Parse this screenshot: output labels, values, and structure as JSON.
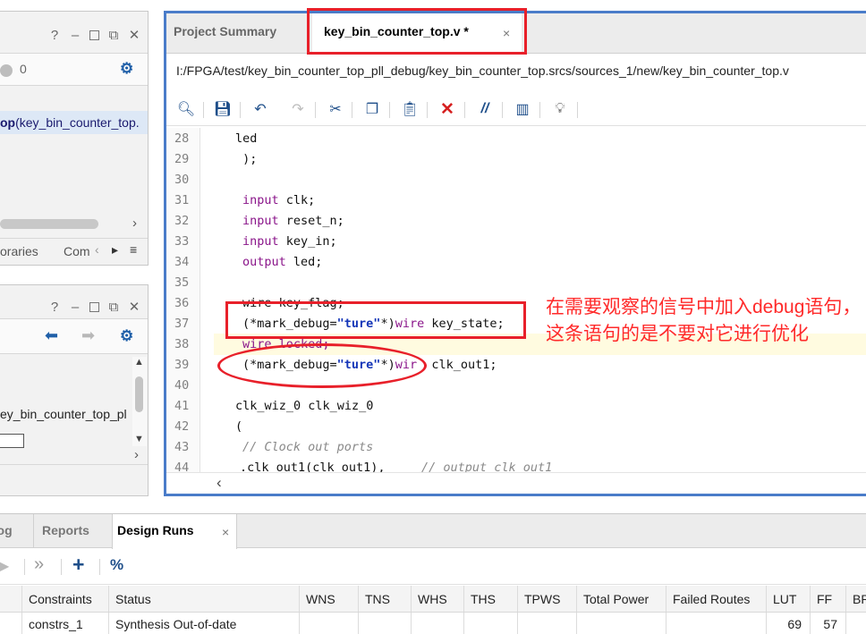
{
  "top_panel": {
    "count": "0",
    "selected_item_bold": "op",
    "selected_item_rest": " (key_bin_counter_top.",
    "tab_libraries": "oraries",
    "tab_compile": "Com",
    "help": "?",
    "minimize": "–",
    "close": "✕"
  },
  "mid_panel": {
    "tree_item": "ey_bin_counter_top_pl",
    "help": "?",
    "minimize": "–",
    "close": "✕"
  },
  "editor": {
    "tab_project_summary": "Project Summary",
    "tab_active": "key_bin_counter_top.v *",
    "tab_close": "×",
    "file_path": "I:/FPGA/test/key_bin_counter_top_pll_debug/key_bin_counter_top.srcs/sources_1/new/key_bin_counter_top.v",
    "line_numbers": [
      "28",
      "29",
      "30",
      "31",
      "32",
      "33",
      "34",
      "35",
      "36",
      "37",
      "38",
      "39",
      "40",
      "41",
      "42",
      "43",
      "44"
    ],
    "lines": {
      "l28": "led",
      "l29": " );",
      "l31_kw": "input",
      "l31_rest": " clk;",
      "l32_kw": "input",
      "l32_rest": " reset_n;",
      "l33_kw": "input",
      "l33_rest": " key_in;",
      "l34_kw": "output",
      "l34_rest": " led;",
      "l36": "wire key_flag;",
      "l37_a": "(*mark_debug=",
      "l37_str": "\"ture\"",
      "l37_b": "*)",
      "l37_kw": "wire",
      "l37_rest": " key_state;",
      "l38": "wire locked;",
      "l39_a": "(*mark_debug=",
      "l39_str": "\"ture\"",
      "l39_b": "*)",
      "l39_kw": "wir",
      "l39_rest": "  clk_out1;",
      "l41": "clk_wiz_0 clk_wiz_0",
      "l42": "(",
      "l43": "// Clock out ports",
      "l44_code": ".clk_out1(clk_out1),",
      "l44_comment": "// output clk_out1"
    }
  },
  "annotation": "在需要观察的信号中加入debug语句，这条语句的是不要对它进行优化",
  "bottom": {
    "tab_log": "Log",
    "tab_reports": "Reports",
    "tab_design_runs": "Design Runs",
    "tab_close": "×",
    "toolbar": {
      "run": "▶",
      "skip": "»",
      "add": "+",
      "percent": "%"
    },
    "columns": [
      "Constraints",
      "Status",
      "WNS",
      "TNS",
      "WHS",
      "THS",
      "TPWS",
      "Total Power",
      "Failed Routes",
      "LUT",
      "FF",
      "BR"
    ],
    "row": {
      "constraints": "constrs_1",
      "status": "Synthesis Out-of-date",
      "lut": "69",
      "ff": "57"
    }
  },
  "colors": {
    "accent_blue": "#4a7cc9",
    "annotation_red": "#ff2a2a",
    "keyword": "#8a158a",
    "string": "#1536b8"
  }
}
